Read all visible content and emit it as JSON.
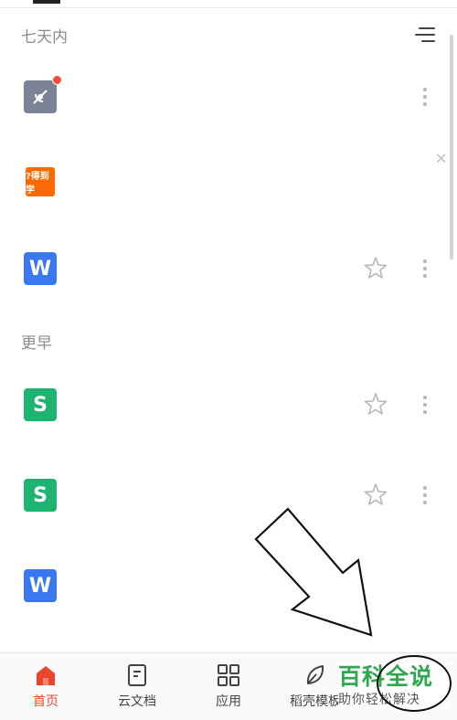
{
  "sections": {
    "recent": "七天内",
    "earlier": "更早"
  },
  "files": [
    {
      "icon": "satellite-app-icon",
      "type": "sat"
    },
    {
      "icon": "ad-app-icon",
      "type": "ad",
      "label": "?得到学"
    },
    {
      "icon": "w",
      "type": "w",
      "letter": "W"
    },
    {
      "icon": "s",
      "type": "s",
      "letter": "S"
    },
    {
      "icon": "s",
      "type": "s",
      "letter": "S"
    },
    {
      "icon": "w",
      "type": "w",
      "letter": "W"
    }
  ],
  "tabs": [
    {
      "label": "首页",
      "icon": "home-icon",
      "active": true
    },
    {
      "label": "云文档",
      "icon": "cloud-doc-icon"
    },
    {
      "label": "应用",
      "icon": "apps-grid-icon"
    },
    {
      "label": "稻壳模板",
      "icon": "leaf-icon"
    }
  ],
  "watermark": {
    "title": "百科全说",
    "subtitle": "助你轻松解决"
  },
  "colors": {
    "accent": "#e8452c",
    "w_doc": "#3a78f2",
    "s_doc": "#1fb372",
    "watermark": "#2fa84f"
  }
}
